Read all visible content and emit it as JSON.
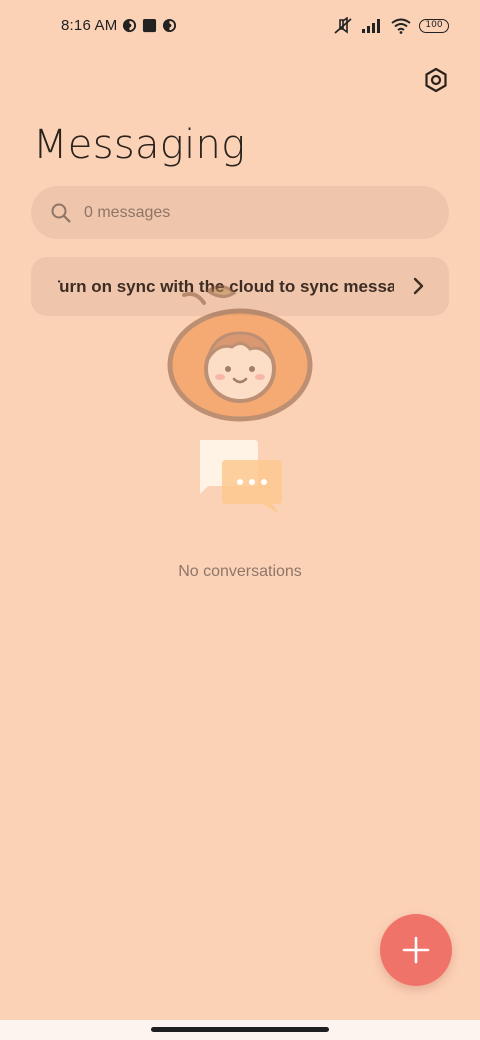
{
  "status_bar": {
    "time": "8:16 AM",
    "left_icons": [
      "data-saver-icon",
      "square-notification-icon",
      "data-saver-icon"
    ],
    "right_icons": [
      "mute-icon",
      "signal-icon",
      "wifi-icon"
    ],
    "battery": "100"
  },
  "header": {
    "title": "Messaging",
    "settings_icon": "settings-hexagon-icon"
  },
  "search": {
    "placeholder": "0 messages"
  },
  "sync_banner": {
    "text": "Turn on sync with the cloud to sync messages"
  },
  "empty_state": {
    "text": "No conversations"
  },
  "fab": {
    "icon": "plus-icon"
  },
  "colors": {
    "background": "#fcd2b7",
    "search_background": "#efc5ab",
    "fab": "#f07369",
    "text_primary": "#2a221d",
    "text_secondary": "#8d766a"
  }
}
